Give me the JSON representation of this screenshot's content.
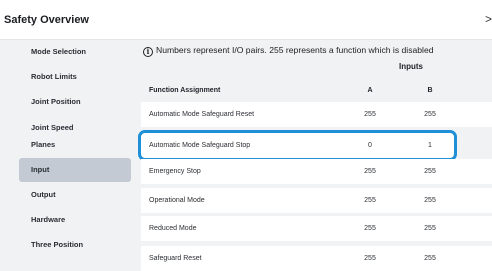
{
  "header": {
    "title": "Safety Overview",
    "chevron_icon": "chevron-right-icon",
    "chevron_glyph": ">"
  },
  "sidebar": {
    "items": [
      {
        "label": "Mode Selection",
        "active": false
      },
      {
        "label": "Robot Limits",
        "active": false
      },
      {
        "label": "Joint Position",
        "active": false
      },
      {
        "label": "Joint Speed",
        "active": false
      },
      {
        "label": "Planes",
        "active": false
      },
      {
        "label": "Input",
        "active": true
      },
      {
        "label": "Output",
        "active": false
      },
      {
        "label": "Hardware",
        "active": false
      },
      {
        "label": "Three Position",
        "active": false
      }
    ]
  },
  "main": {
    "info_icon": "info-icon",
    "info_glyph": "i",
    "note": "Numbers represent I/O pairs. 255 represents a function which is disabled",
    "inputs_label": "Inputs",
    "table": {
      "headers": {
        "function": "Function Assignment",
        "a": "A",
        "b": "B"
      },
      "rows": [
        {
          "name": "Automatic Mode Safeguard Reset",
          "a": "255",
          "b": "255",
          "highlighted": false
        },
        {
          "name": "Automatic Mode Safeguard Stop",
          "a": "0",
          "b": "1",
          "highlighted": true
        },
        {
          "name": "Emergency Stop",
          "a": "255",
          "b": "255",
          "highlighted": false
        },
        {
          "name": "Operational Mode",
          "a": "255",
          "b": "255",
          "highlighted": false
        },
        {
          "name": "Reduced Mode",
          "a": "255",
          "b": "255",
          "highlighted": false
        },
        {
          "name": "Safeguard Reset",
          "a": "255",
          "b": "255",
          "highlighted": false
        }
      ]
    }
  },
  "colors": {
    "accent": "#1f8fd8",
    "active_item": "#c3cad3",
    "panel_bg": "#f1f2f4"
  }
}
